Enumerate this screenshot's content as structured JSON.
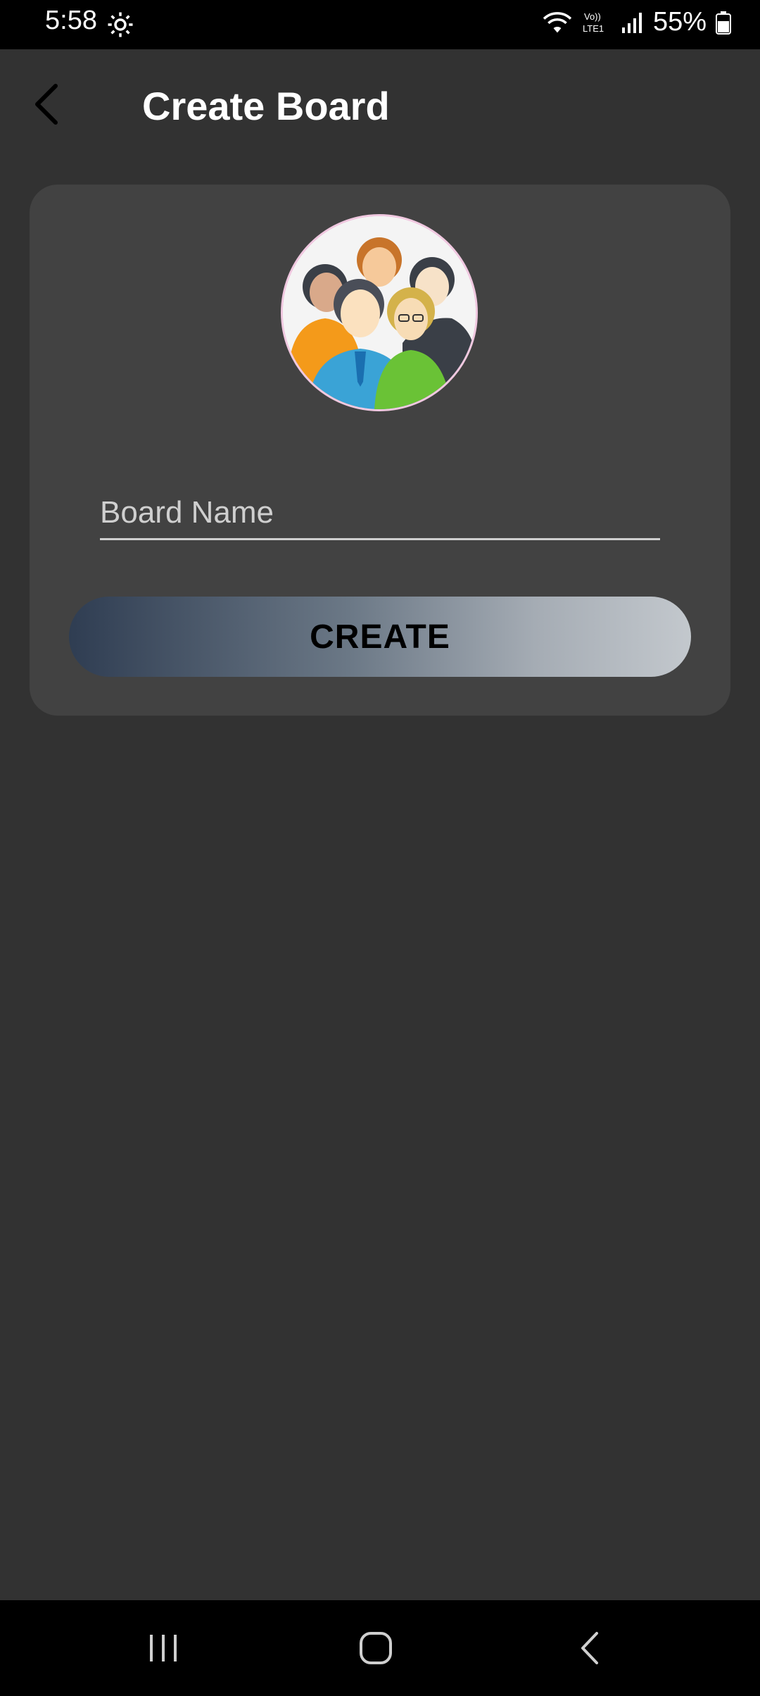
{
  "status_bar": {
    "time": "5:58",
    "battery_percent": "55%",
    "icons": [
      "gear-icon",
      "wifi-icon",
      "volte-icon",
      "signal-icon",
      "battery-icon"
    ]
  },
  "header": {
    "title": "Create Board",
    "back_icon": "back-arrow-icon"
  },
  "form": {
    "avatar": "group-of-people-avatar",
    "board_name_placeholder": "Board Name",
    "board_name_value": "",
    "create_label": "CREATE"
  },
  "nav_bar": {
    "icons": [
      "recent-apps-icon",
      "home-icon",
      "back-icon"
    ]
  },
  "colors": {
    "background": "#323232",
    "card": "#424242",
    "button_gradient_start": "#2f3d52",
    "button_gradient_end": "#c3c8cd"
  }
}
